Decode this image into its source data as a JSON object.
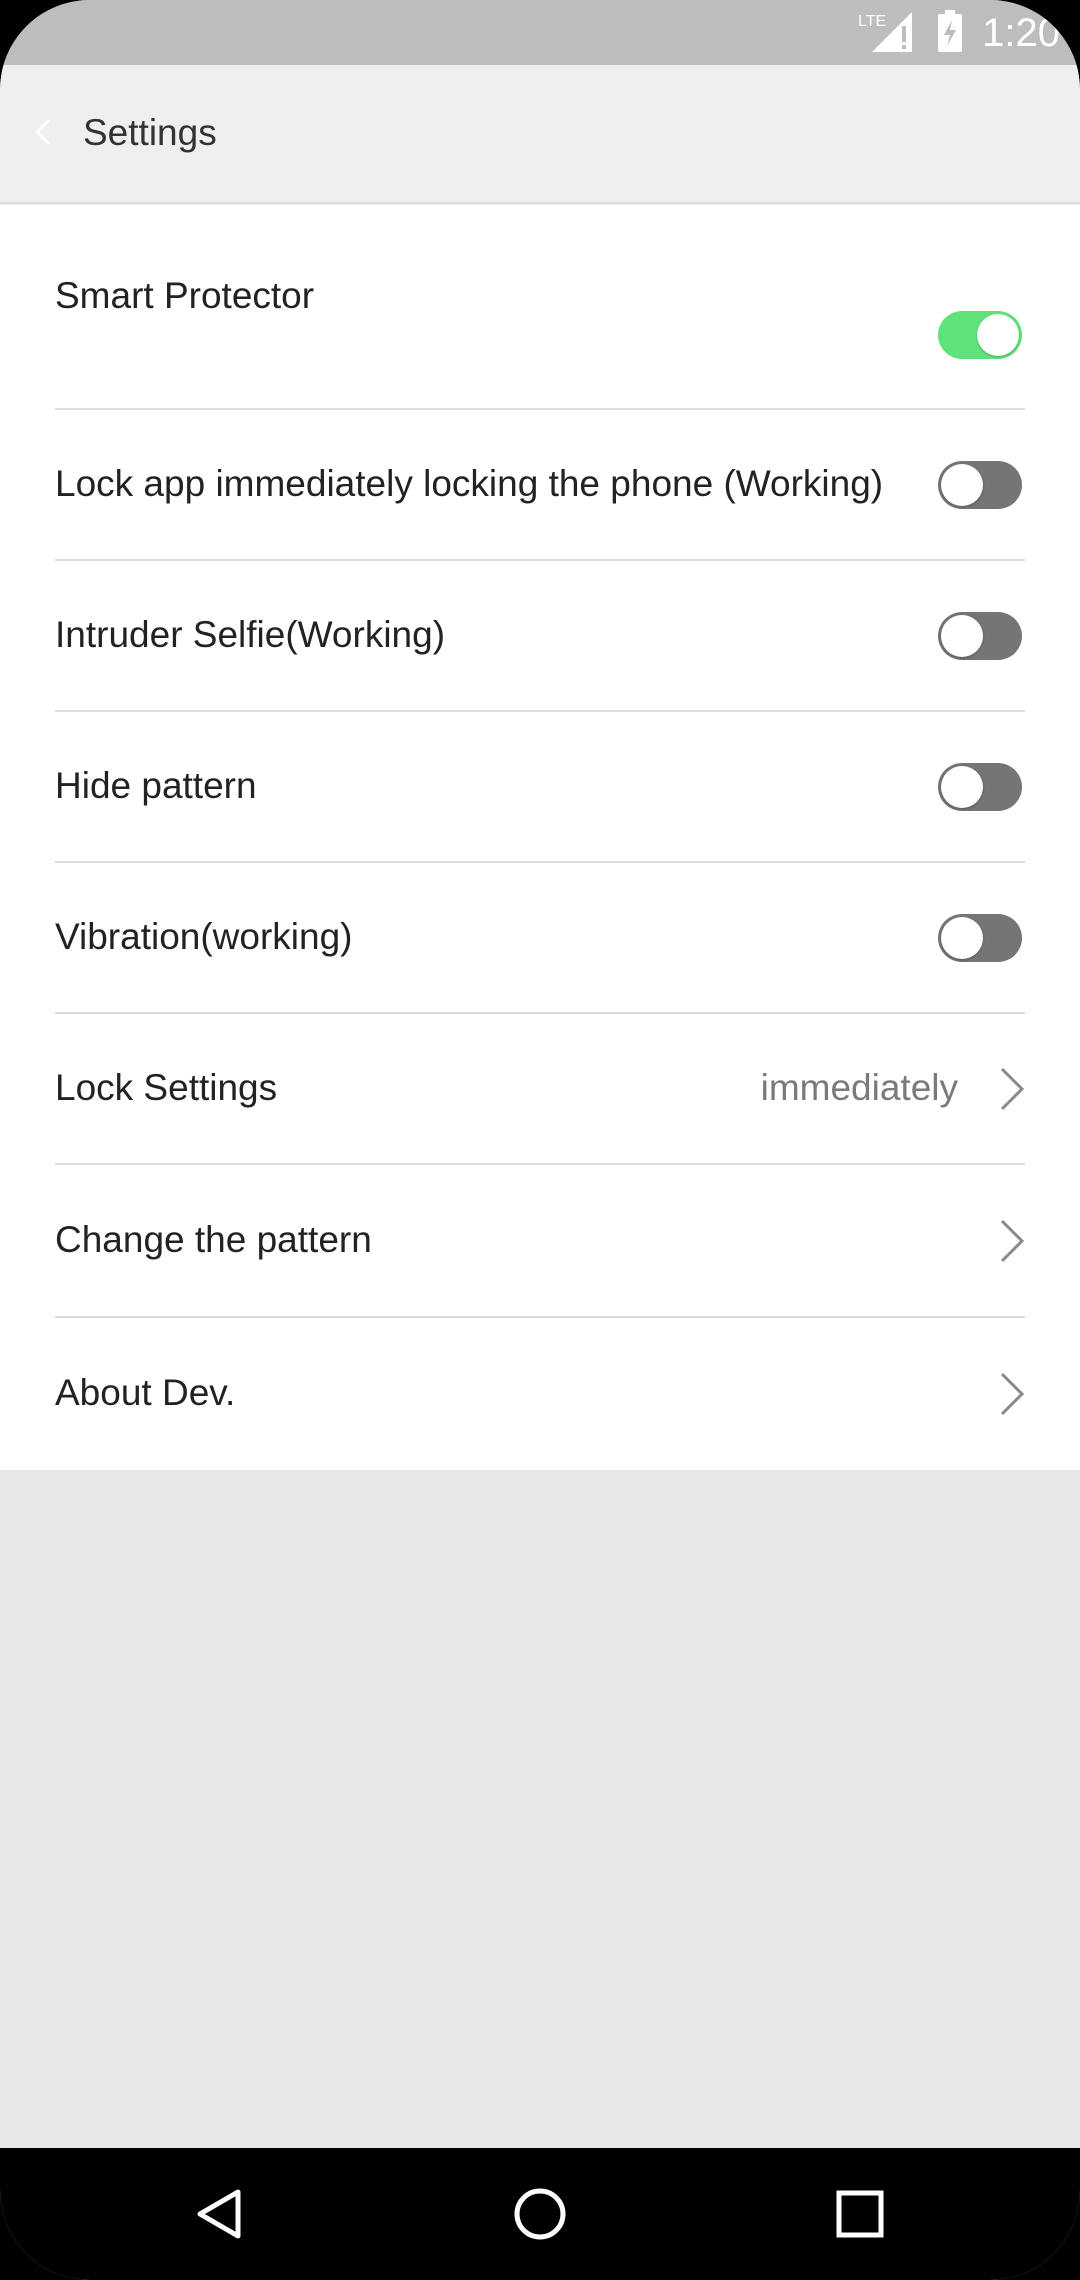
{
  "status_bar": {
    "time": "1:20",
    "network": "LTE",
    "icons": [
      "lte-signal-icon",
      "battery-charging-icon"
    ]
  },
  "header": {
    "back_icon": "chevron-left-icon",
    "title": "Settings"
  },
  "settings": [
    {
      "label": "Smart Protector",
      "type": "toggle",
      "enabled": true
    },
    {
      "label": "Lock app immediately locking the phone (Working)",
      "type": "toggle",
      "enabled": false
    },
    {
      "label": "Intruder Selfie(Working)",
      "type": "toggle",
      "enabled": false
    },
    {
      "label": "Hide pattern",
      "type": "toggle",
      "enabled": false
    },
    {
      "label": "Vibration(working)",
      "type": "toggle",
      "enabled": false
    },
    {
      "label": "Lock Settings",
      "type": "link",
      "value": "immediately"
    },
    {
      "label": "Change the pattern",
      "type": "link"
    },
    {
      "label": "About Dev.",
      "type": "link"
    }
  ],
  "nav_bar": {
    "buttons": [
      "back-triangle-icon",
      "home-circle-icon",
      "recents-square-icon"
    ]
  },
  "colors": {
    "toggle_on": "#5fe27a",
    "toggle_off": "#757575",
    "status_bar": "#bdbdbd",
    "header_bg": "#efefef",
    "page_bg": "#e8e8e8"
  }
}
